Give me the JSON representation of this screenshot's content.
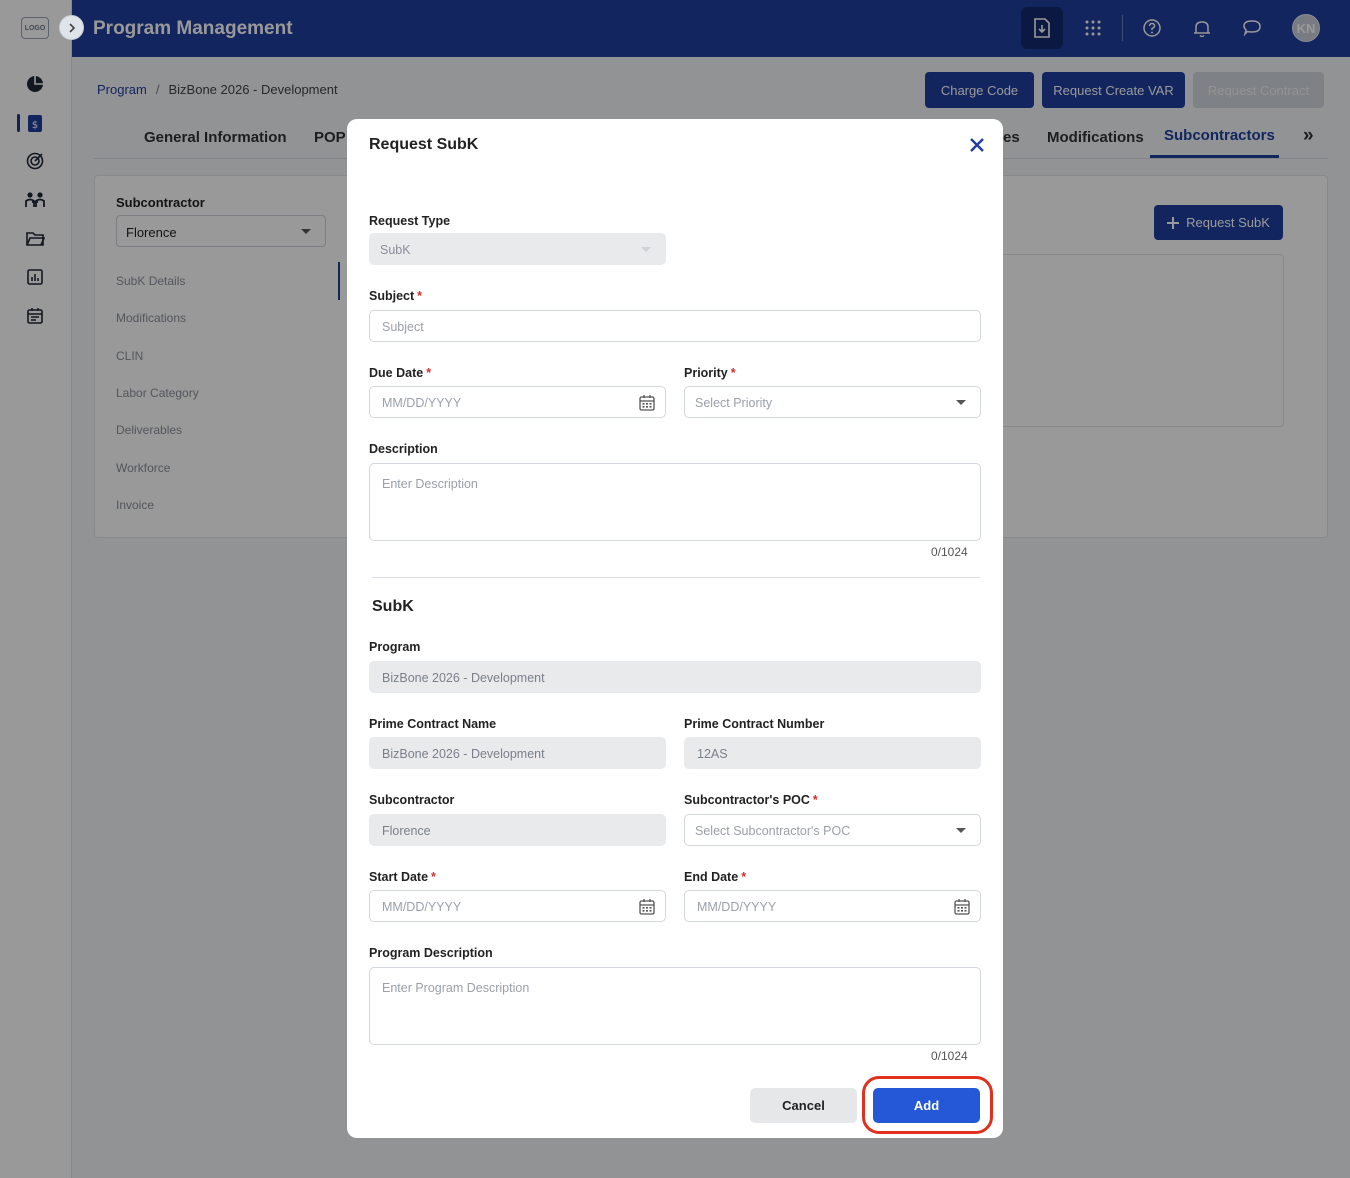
{
  "app": {
    "logo_text": "LOGO",
    "title": "Program Management",
    "avatar_initials": "KN"
  },
  "breadcrumb": {
    "root": "Program",
    "separator": "/",
    "current": "BizBone 2026 - Development"
  },
  "actions": {
    "charge_code": "Charge Code",
    "request_create_var": "Request Create VAR",
    "request_contract": "Request Contract"
  },
  "tabs": [
    {
      "label": "General Information"
    },
    {
      "label": "POP"
    },
    {
      "label": "es"
    },
    {
      "label": "Modifications"
    },
    {
      "label": "Subcontractors"
    }
  ],
  "tabs_more": "»",
  "panel": {
    "subcontractor_label": "Subcontractor",
    "subcontractor_value": "Florence",
    "nav": [
      "SubK Details",
      "Modifications",
      "CLIN",
      "Labor Category",
      "Deliverables",
      "Workforce",
      "Invoice"
    ],
    "request_subk_button": "Request SubK"
  },
  "modal": {
    "title": "Request SubK",
    "request_type": {
      "label": "Request Type",
      "value": "SubK"
    },
    "subject": {
      "label": "Subject",
      "required": "*",
      "placeholder": "Subject"
    },
    "due_date": {
      "label": "Due Date",
      "required": "*",
      "placeholder": "MM/DD/YYYY"
    },
    "priority": {
      "label": "Priority",
      "required": "*",
      "placeholder": "Select Priority"
    },
    "description": {
      "label": "Description",
      "placeholder": "Enter Description",
      "counter": "0/1024"
    },
    "section_title": "SubK",
    "program": {
      "label": "Program",
      "value": "BizBone 2026 - Development"
    },
    "prime_contract_name": {
      "label": "Prime Contract Name",
      "value": "BizBone 2026 - Development"
    },
    "prime_contract_number": {
      "label": "Prime Contract Number",
      "value": "12AS"
    },
    "subcontractor": {
      "label": "Subcontractor",
      "value": "Florence"
    },
    "subcontractor_poc": {
      "label": "Subcontractor's POC",
      "required": "*",
      "placeholder": "Select Subcontractor's POC"
    },
    "start_date": {
      "label": "Start Date",
      "required": "*",
      "placeholder": "MM/DD/YYYY"
    },
    "end_date": {
      "label": "End Date",
      "required": "*",
      "placeholder": "MM/DD/YYYY"
    },
    "program_description": {
      "label": "Program Description",
      "placeholder": "Enter Program Description",
      "counter": "0/1024"
    },
    "cancel_button": "Cancel",
    "add_button": "Add"
  },
  "colors": {
    "header": "#1f3f9e",
    "primary_button": "#2458d6",
    "required": "#d32f2f",
    "highlight": "#e0301e"
  }
}
